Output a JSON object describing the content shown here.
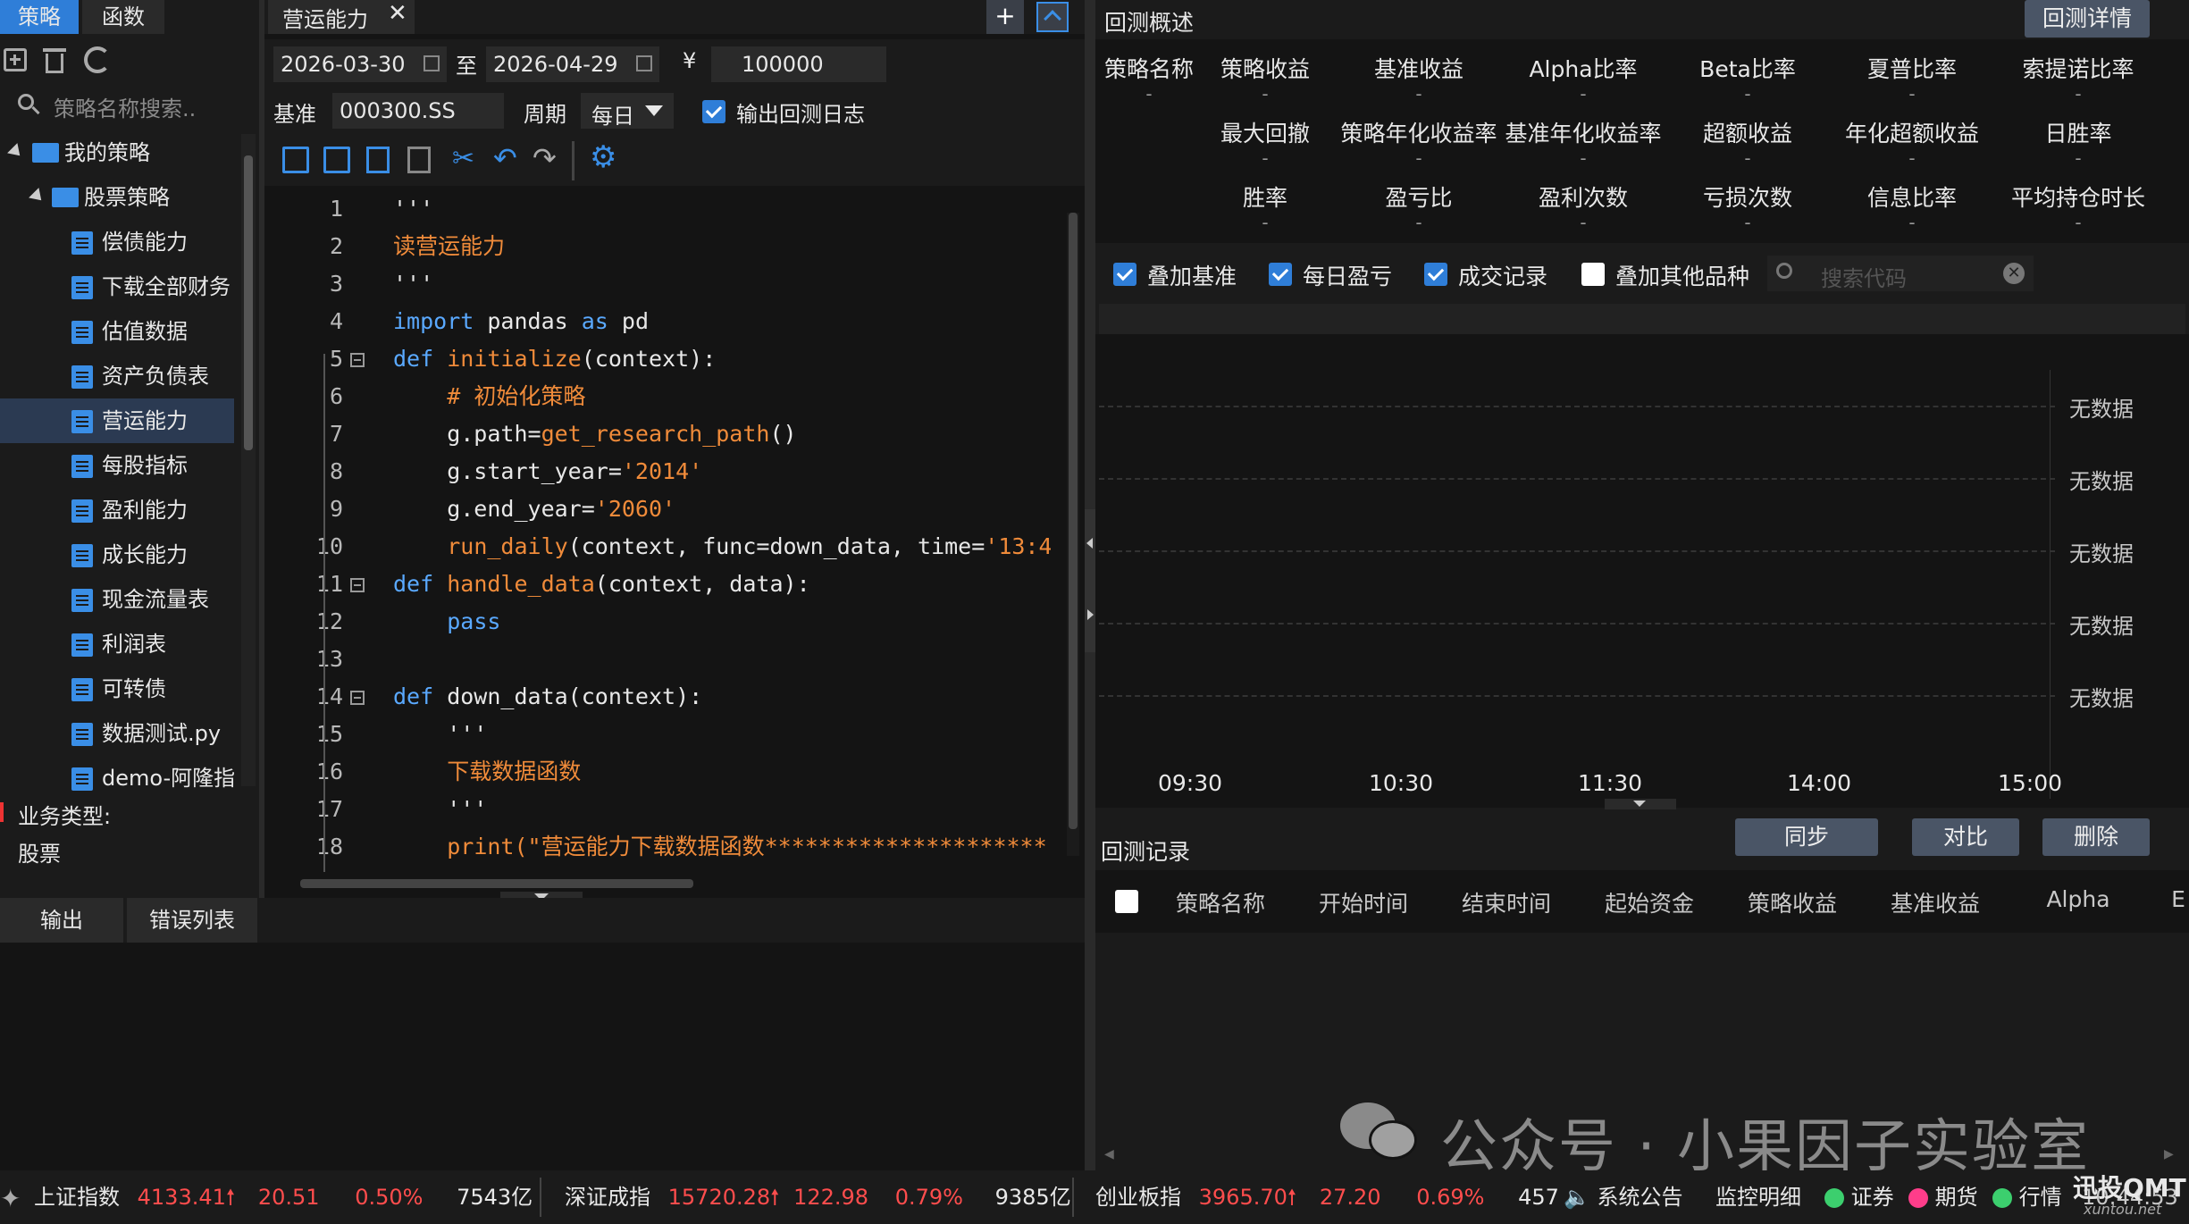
{
  "left_tabs": {
    "strategy": "策略",
    "function": "函数"
  },
  "search": {
    "placeholder": "策略名称搜索.."
  },
  "tree": {
    "root": "我的策略",
    "folder": "股票策略",
    "items": [
      "偿债能力",
      "下载全部财务",
      "估值数据",
      "资产负债表",
      "营运能力",
      "每股指标",
      "盈利能力",
      "成长能力",
      "现金流量表",
      "利润表",
      "可转债",
      "数据测试.py",
      "demo-阿隆指"
    ],
    "selected_index": 4
  },
  "biz": {
    "label": "业务类型:",
    "value": "股票"
  },
  "bottom_tabs": {
    "output": "输出",
    "errors": "错误列表"
  },
  "editor": {
    "tab_title": "营运能力",
    "start_date": "2026-03-30",
    "to_label": "至",
    "end_date": "2026-04-29",
    "currency": "¥",
    "capital": "100000",
    "benchmark_label": "基准",
    "benchmark": "000300.SS",
    "period_label": "周期",
    "period": "每日",
    "log_label": "输出回测日志"
  },
  "overview": {
    "title": "回测概述",
    "detail_button": "回测详情",
    "row1": [
      "策略名称",
      "策略收益",
      "基准收益",
      "Alpha比率",
      "Beta比率",
      "夏普比率",
      "索提诺比率"
    ],
    "row2": [
      "最大回撤",
      "策略年化收益率",
      "基准年化收益率",
      "超额收益",
      "年化超额收益",
      "日胜率"
    ],
    "row3": [
      "胜率",
      "盈亏比",
      "盈利次数",
      "亏损次数",
      "信息比率",
      "平均持仓时长"
    ],
    "placeholder": "-"
  },
  "options": {
    "overlay_benchmark": "叠加基准",
    "daily_pnl": "每日盈亏",
    "trades": "成交记录",
    "overlay_other": "叠加其他品种",
    "search_placeholder": "搜索代码"
  },
  "chart": {
    "no_data": "无数据",
    "x_ticks": [
      "09:30",
      "10:30",
      "11:30",
      "14:00",
      "15:00"
    ]
  },
  "records": {
    "title": "回测记录",
    "sync": "同步",
    "compare": "对比",
    "delete": "删除",
    "columns": [
      "策略名称",
      "开始时间",
      "结束时间",
      "起始资金",
      "策略收益",
      "基准收益",
      "Alpha",
      "E"
    ]
  },
  "watermark": "公众号 · 小果因子实验室",
  "status": {
    "sh": {
      "name": "上证指数",
      "price": "4133.41",
      "chg": "20.51",
      "pct": "0.50%",
      "vol": "7543亿"
    },
    "sz": {
      "name": "深证成指",
      "price": "15720.28",
      "chg": "122.98",
      "pct": "0.79%",
      "vol": "9385亿"
    },
    "cy": {
      "name": "创业板指",
      "price": "3965.70",
      "chg": "27.20",
      "pct": "0.69%",
      "vol": "457"
    },
    "notice": "系统公告",
    "monitor": "监控明细",
    "stock": "证券",
    "futures": "期货",
    "quote": "行情",
    "time": "10:44:53",
    "brand": "迅投QMT",
    "brand_url": "xuntou.net"
  },
  "colors": {
    "accent": "#2f7ed8",
    "up": "#ff4d4d",
    "status_green": "#3ccf6e",
    "status_pink": "#ff3d8a"
  }
}
